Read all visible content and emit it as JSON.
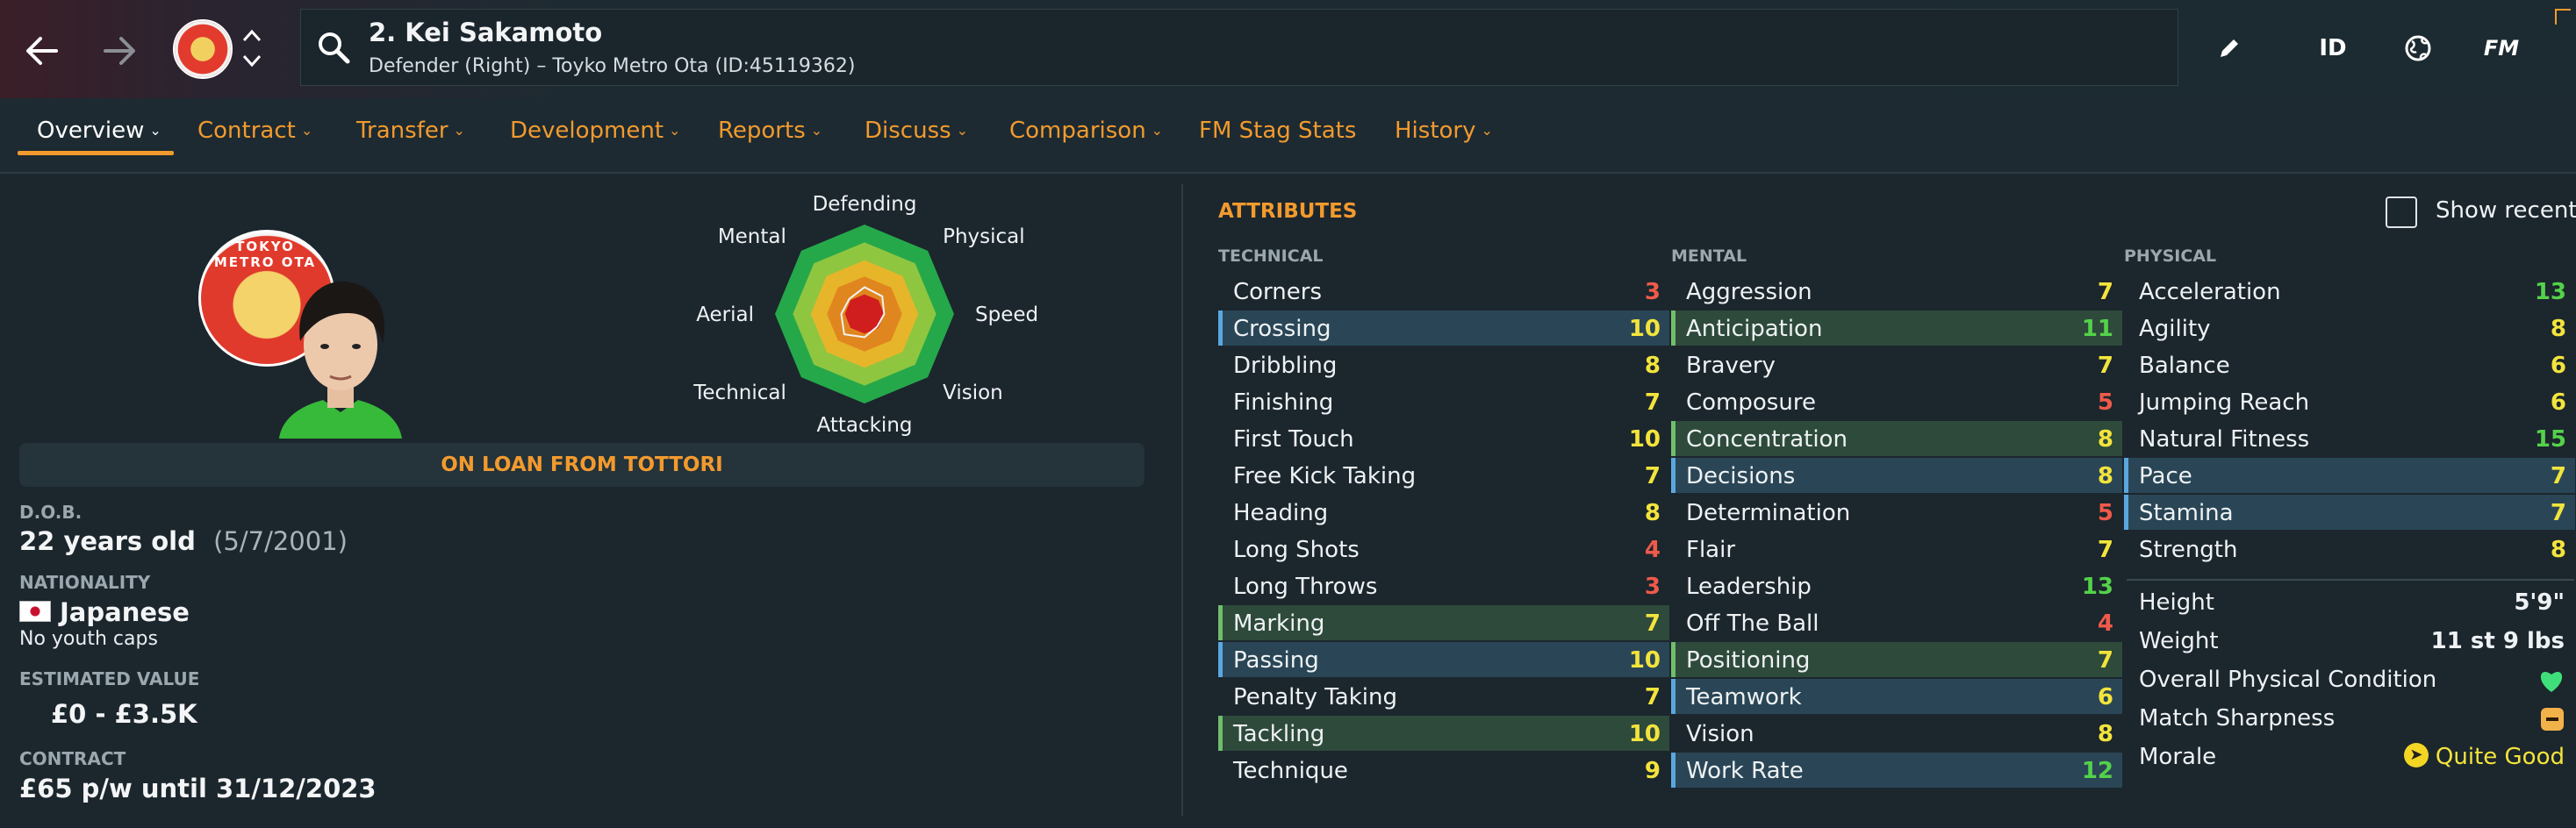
{
  "header": {
    "player_title": "2. Kei Sakamoto",
    "player_subtitle": "Defender (Right) – Toyko Metro Ota (ID:45119362)",
    "toolbar": {
      "id_label": "ID",
      "fm_label": "FM"
    }
  },
  "tabs": [
    {
      "label": "Overview"
    },
    {
      "label": "Contract"
    },
    {
      "label": "Transfer"
    },
    {
      "label": "Development"
    },
    {
      "label": "Reports"
    },
    {
      "label": "Discuss"
    },
    {
      "label": "Comparison"
    },
    {
      "label": "FM Stag Stats"
    },
    {
      "label": "History"
    }
  ],
  "radar": {
    "labels": [
      "Defending",
      "Physical",
      "Speed",
      "Vision",
      "Attacking",
      "Technical",
      "Aerial",
      "Mental"
    ],
    "values": [
      0.3,
      0.28,
      0.22,
      0.2,
      0.26,
      0.32,
      0.26,
      0.24
    ]
  },
  "profile": {
    "club_badge_text": "TOKYO METRO OTA",
    "loan_text": "ON LOAN FROM TOTTORI",
    "dob_label": "D.O.B.",
    "age": "22 years old",
    "dob": "(5/7/2001)",
    "nationality_label": "NATIONALITY",
    "nationality": "Japanese",
    "youth_caps": "No youth caps",
    "value_label": "ESTIMATED VALUE",
    "value": "£0 - £3.5K",
    "contract_label": "CONTRACT",
    "contract": "£65 p/w until 31/12/2023"
  },
  "attributes": {
    "title": "ATTRIBUTES",
    "show_recent": "Show recent",
    "technical_label": "TECHNICAL",
    "mental_label": "MENTAL",
    "physical_label": "PHYSICAL",
    "technical": [
      {
        "name": "Corners",
        "value": "3"
      },
      {
        "name": "Crossing",
        "value": "10"
      },
      {
        "name": "Dribbling",
        "value": "8"
      },
      {
        "name": "Finishing",
        "value": "7"
      },
      {
        "name": "First Touch",
        "value": "10"
      },
      {
        "name": "Free Kick Taking",
        "value": "7"
      },
      {
        "name": "Heading",
        "value": "8"
      },
      {
        "name": "Long Shots",
        "value": "4"
      },
      {
        "name": "Long Throws",
        "value": "3"
      },
      {
        "name": "Marking",
        "value": "7"
      },
      {
        "name": "Passing",
        "value": "10"
      },
      {
        "name": "Penalty Taking",
        "value": "7"
      },
      {
        "name": "Tackling",
        "value": "10"
      },
      {
        "name": "Technique",
        "value": "9"
      }
    ],
    "mental": [
      {
        "name": "Aggression",
        "value": "7"
      },
      {
        "name": "Anticipation",
        "value": "11"
      },
      {
        "name": "Bravery",
        "value": "7"
      },
      {
        "name": "Composure",
        "value": "5"
      },
      {
        "name": "Concentration",
        "value": "8"
      },
      {
        "name": "Decisions",
        "value": "8"
      },
      {
        "name": "Determination",
        "value": "5"
      },
      {
        "name": "Flair",
        "value": "7"
      },
      {
        "name": "Leadership",
        "value": "13"
      },
      {
        "name": "Off The Ball",
        "value": "4"
      },
      {
        "name": "Positioning",
        "value": "7"
      },
      {
        "name": "Teamwork",
        "value": "6"
      },
      {
        "name": "Vision",
        "value": "8"
      },
      {
        "name": "Work Rate",
        "value": "12"
      }
    ],
    "physical": [
      {
        "name": "Acceleration",
        "value": "13"
      },
      {
        "name": "Agility",
        "value": "8"
      },
      {
        "name": "Balance",
        "value": "6"
      },
      {
        "name": "Jumping Reach",
        "value": "6"
      },
      {
        "name": "Natural Fitness",
        "value": "15"
      },
      {
        "name": "Pace",
        "value": "7"
      },
      {
        "name": "Stamina",
        "value": "7"
      },
      {
        "name": "Strength",
        "value": "8"
      }
    ],
    "info": {
      "height_label": "Height",
      "height": "5'9\"",
      "weight_label": "Weight",
      "weight": "11 st 9 lbs",
      "condition_label": "Overall Physical Condition",
      "sharpness_label": "Match Sharpness",
      "morale_label": "Morale",
      "morale": "Quite Good"
    }
  },
  "colors": {
    "accent": "#f29a2e",
    "low": "#f05a4a",
    "mid": "#f3e43c",
    "high": "#54d24a"
  }
}
